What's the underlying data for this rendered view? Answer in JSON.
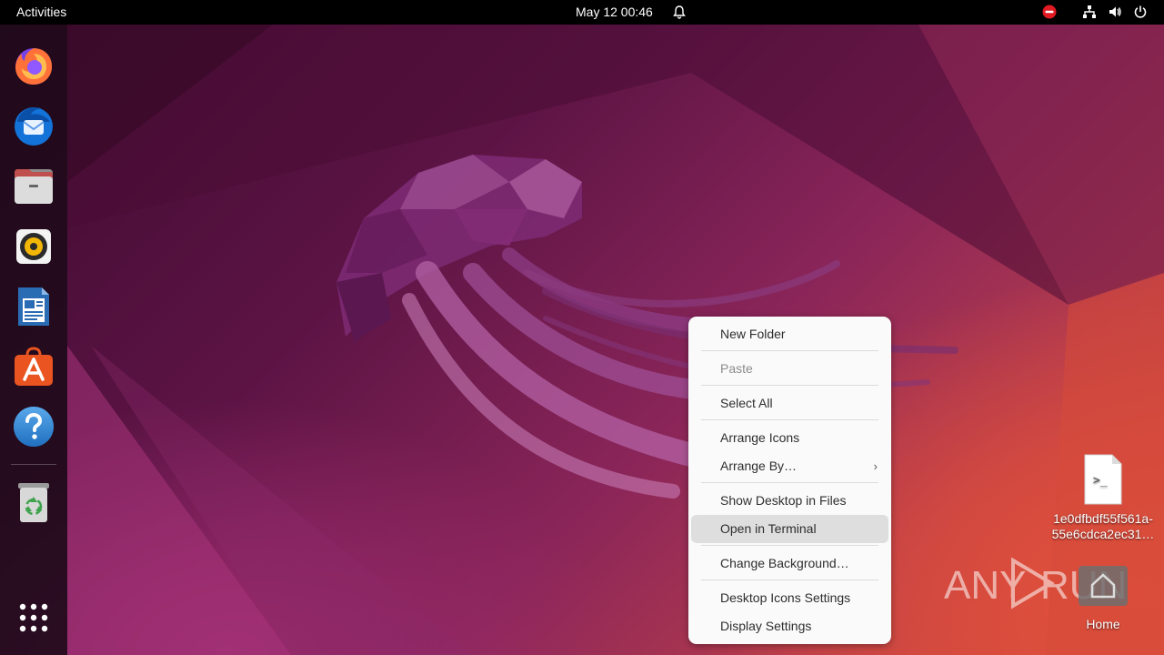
{
  "topbar": {
    "activities": "Activities",
    "clock": "May 12  00:46",
    "tray_icons": [
      "do-not-disturb-icon",
      "network-icon",
      "volume-icon",
      "power-icon"
    ]
  },
  "dock": {
    "apps": [
      "Firefox",
      "Thunderbird",
      "Files",
      "Rhythmbox",
      "LibreOffice Writer",
      "Ubuntu Software",
      "Help",
      "Trash"
    ],
    "show_apps": "show-applications-icon"
  },
  "desktop": {
    "file_icon_label_line1": "1e0dfbdf55f561a-",
    "file_icon_label_line2": "55e6cdca2ec31…",
    "home_label": "Home"
  },
  "context_menu": {
    "new_folder": "New Folder",
    "paste": "Paste",
    "select_all": "Select All",
    "arrange_icons": "Arrange Icons",
    "arrange_by": "Arrange By…",
    "arrange_by_arrow": "›",
    "show_desktop_in_files": "Show Desktop in Files",
    "open_in_terminal": "Open in Terminal",
    "change_background": "Change Background…",
    "desktop_icons_settings": "Desktop Icons Settings",
    "display_settings": "Display Settings"
  },
  "watermark": {
    "text_left": "ANY",
    "text_right": "RUN"
  },
  "colors": {
    "topbar": "#000000",
    "menu_bg": "#fafafa",
    "menu_hover": "#dedede",
    "accent_orange": "#e95420"
  }
}
